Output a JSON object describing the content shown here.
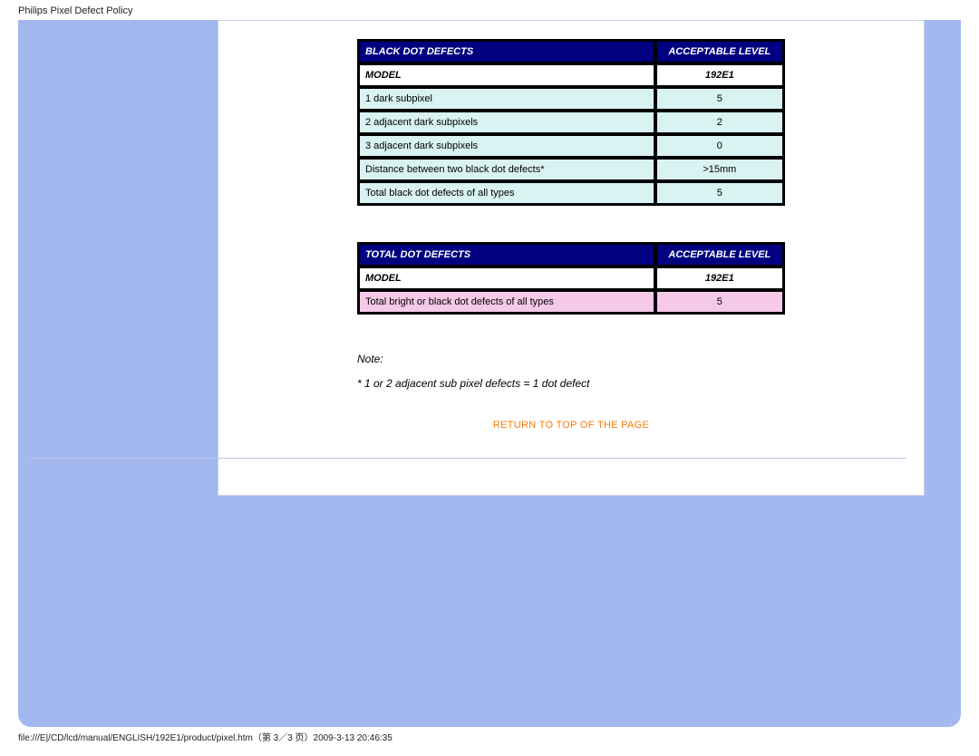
{
  "header": {
    "title": "Philips Pixel Defect Policy"
  },
  "tables": {
    "black": {
      "header_left": "BLACK DOT DEFECTS",
      "header_right": "ACCEPTABLE LEVEL",
      "model_label": "MODEL",
      "model_value": "192E1",
      "rows": [
        {
          "label": "1 dark subpixel",
          "value": "5"
        },
        {
          "label": "2 adjacent dark subpixels",
          "value": "2"
        },
        {
          "label": "3 adjacent dark subpixels",
          "value": "0"
        },
        {
          "label": "Distance between two black dot defects*",
          "value": ">15mm"
        },
        {
          "label": "Total black dot defects of all types",
          "value": "5"
        }
      ]
    },
    "total": {
      "header_left": "TOTAL DOT DEFECTS",
      "header_right": "ACCEPTABLE LEVEL",
      "model_label": "MODEL",
      "model_value": "192E1",
      "rows": [
        {
          "label": "Total bright or black dot defects of all types",
          "value": "5"
        }
      ]
    }
  },
  "note": {
    "label": "Note:",
    "text": "* 1 or 2 adjacent sub pixel defects = 1 dot defect"
  },
  "return_link": "RETURN TO TOP OF THE PAGE",
  "footer": "file:///E|/CD/lcd/manual/ENGLISH/192E1/product/pixel.htm（第 3／3 页）2009-3-13 20:46:35"
}
